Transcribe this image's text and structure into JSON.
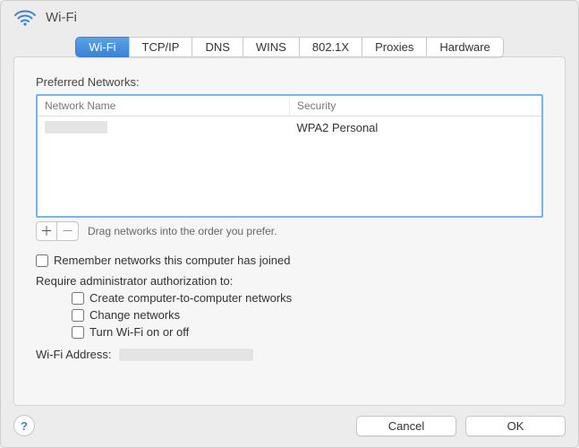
{
  "title": "Wi-Fi",
  "tabs": [
    "Wi-Fi",
    "TCP/IP",
    "DNS",
    "WINS",
    "802.1X",
    "Proxies",
    "Hardware"
  ],
  "activeTab": 0,
  "preferred_label": "Preferred Networks:",
  "columns": {
    "name": "Network Name",
    "security": "Security"
  },
  "networks": [
    {
      "name_redacted": true,
      "security": "WPA2 Personal"
    }
  ],
  "drag_hint": "Drag networks into the order you prefer.",
  "remember_label": "Remember networks this computer has joined",
  "admin_label": "Require administrator authorization to:",
  "admin_opts": {
    "create": "Create computer-to-computer networks",
    "change": "Change networks",
    "toggle": "Turn Wi-Fi on or off"
  },
  "wifi_addr_label": "Wi-Fi Address:",
  "buttons": {
    "cancel": "Cancel",
    "ok": "OK"
  },
  "plus": "＋",
  "minus": "－",
  "help": "?"
}
